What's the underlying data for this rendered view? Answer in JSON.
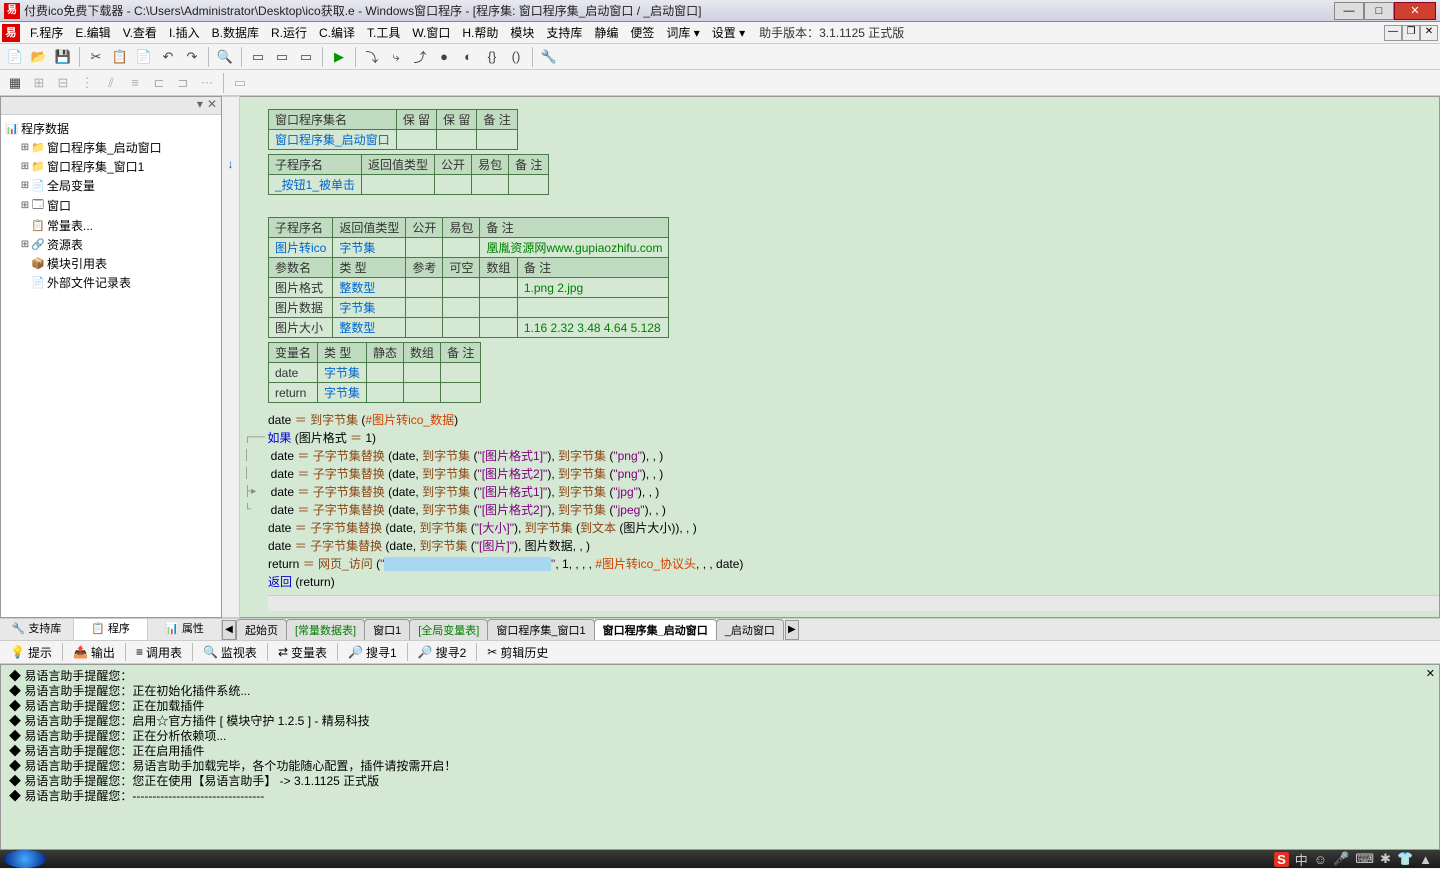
{
  "window": {
    "title": "付费ico免费下载器 - C:\\Users\\Administrator\\Desktop\\ico获取.e - Windows窗口程序 - [程序集: 窗口程序集_启动窗口 / _启动窗口]"
  },
  "menu": {
    "file": "F.程序",
    "edit": "E.编辑",
    "view": "V.查看",
    "insert": "I.插入",
    "db": "B.数据库",
    "run": "R.运行",
    "compile": "C.编译",
    "tools": "T.工具",
    "window": "W.窗口",
    "help": "H.帮助",
    "module": "模块",
    "support": "支持库",
    "static": "静编",
    "note": "便签",
    "dict": "词库 ▾",
    "settings": "设置 ▾",
    "version": "助手版本：3.1.1125 正式版"
  },
  "sidebar": {
    "header": "程序数据",
    "items": [
      {
        "l": 2,
        "exp": "⊞",
        "icon": "📁",
        "label": "窗口程序集_启动窗口"
      },
      {
        "l": 2,
        "exp": "⊞",
        "icon": "📁",
        "label": "窗口程序集_窗口1"
      },
      {
        "l": 2,
        "exp": "⊞",
        "icon": "📄",
        "label": "全局变量"
      },
      {
        "l": 2,
        "exp": "⊞",
        "icon": "🗔",
        "label": "窗口"
      },
      {
        "l": 2,
        "exp": "",
        "icon": "📋",
        "label": "常量表..."
      },
      {
        "l": 2,
        "exp": "⊞",
        "icon": "🔗",
        "label": "资源表"
      },
      {
        "l": 2,
        "exp": "",
        "icon": "📦",
        "label": "模块引用表"
      },
      {
        "l": 2,
        "exp": "",
        "icon": "📄",
        "label": "外部文件记录表"
      }
    ],
    "tabs": [
      "🔧 支持库",
      "📋 程序",
      "📊 属性"
    ]
  },
  "table1": {
    "headers": [
      "窗口程序集名",
      "保  留",
      "保  留",
      "备 注"
    ],
    "row": [
      "窗口程序集_启动窗口",
      "",
      "",
      ""
    ]
  },
  "table2": {
    "headers": [
      "子程序名",
      "返回值类型",
      "公开",
      "易包",
      "备  注"
    ],
    "row": [
      "_按钮1_被单击",
      "",
      "",
      "",
      ""
    ]
  },
  "table3": {
    "headers1": [
      "子程序名",
      "返回值类型",
      "公开",
      "易包",
      "备  注"
    ],
    "row1": [
      "图片转ico",
      "字节集",
      "",
      "",
      "凰胤资源网www.gupiaozhifu.com"
    ],
    "headers2": [
      "参数名",
      "类  型",
      "参考",
      "可空",
      "数组",
      "备  注"
    ],
    "rows2": [
      [
        "图片格式",
        "整数型",
        "",
        "",
        "",
        "1.png  2.jpg"
      ],
      [
        "图片数据",
        "字节集",
        "",
        "",
        "",
        ""
      ],
      [
        "图片大小",
        "整数型",
        "",
        "",
        "",
        "1.16  2.32  3.48  4.64  5.128"
      ]
    ]
  },
  "table4": {
    "headers": [
      "变量名",
      "类 型",
      "静态",
      "数组",
      "备 注"
    ],
    "rows": [
      [
        "date",
        "字节集",
        "",
        "",
        ""
      ],
      [
        "return",
        "字节集",
        "",
        "",
        ""
      ]
    ]
  },
  "code": {
    "l1": "date ＝ 到字节集 (#图片转ico_数据)",
    "l2": "如果 (图片格式 ＝ 1)",
    "l3": "date ＝ 子字节集替换 (date, 到字节集 (\"[图片格式1]\"), 到字节集 (\"png\"), , )",
    "l4": "date ＝ 子字节集替换 (date, 到字节集 (\"[图片格式2]\"), 到字节集 (\"png\"), , )",
    "l5": "date ＝ 子字节集替换 (date, 到字节集 (\"[图片格式1]\"), 到字节集 (\"jpg\"), , )",
    "l6": "date ＝ 子字节集替换 (date, 到字节集 (\"[图片格式2]\"), 到字节集 (\"jpeg\"), , )",
    "l7": "date ＝ 子字节集替换 (date, 到字节集 (\"[大小]\"), 到字节集 (到文本 (图片大小)), , )",
    "l8": "date ＝ 子字节集替换 (date, 到字节集 (\"[图片]\"), 图片数据, , )",
    "l9_a": "return ＝ 网页_访问 (\"",
    "l9_b": "\", 1, , , , #图片转ico_协议头, , , date)",
    "l10": "返回 (return)"
  },
  "editortabs": [
    {
      "label": "起始页",
      "cls": ""
    },
    {
      "label": "[常量数据表]",
      "cls": "gt"
    },
    {
      "label": "窗口1",
      "cls": ""
    },
    {
      "label": "[全局变量表]",
      "cls": "gt"
    },
    {
      "label": "窗口程序集_窗口1",
      "cls": ""
    },
    {
      "label": "窗口程序集_启动窗口",
      "cls": "active"
    },
    {
      "label": "_启动窗口",
      "cls": ""
    }
  ],
  "bottomtabs": [
    {
      "i": "💡",
      "t": "提示"
    },
    {
      "i": "📤",
      "t": "输出"
    },
    {
      "i": "≡",
      "t": "调用表"
    },
    {
      "i": "🔍",
      "t": "监视表"
    },
    {
      "i": "⇄",
      "t": "变量表"
    },
    {
      "i": "🔎",
      "t": "搜寻1"
    },
    {
      "i": "🔎",
      "t": "搜寻2"
    },
    {
      "i": "✂",
      "t": "剪辑历史"
    }
  ],
  "output": {
    "lines": [
      "◆ 易语言助手提醒您：",
      "◆ 易语言助手提醒您：正在初始化插件系统...",
      "◆ 易语言助手提醒您：正在加载插件",
      "◆ 易语言助手提醒您：启用☆官方插件 [ 模块守护 1.2.5 ] - 精易科技",
      "◆ 易语言助手提醒您：正在分析依赖项...",
      "◆ 易语言助手提醒您：正在启用插件",
      "◆ 易语言助手提醒您：易语言助手加载完毕，各个功能随心配置，插件请按需开启！",
      "◆ 易语言助手提醒您：您正在使用【易语言助手】 -> 3.1.1125 正式版",
      "◆ 易语言助手提醒您：---------------------------------"
    ]
  },
  "tray": [
    "中",
    "☺",
    "🎤",
    "⌨",
    "✱",
    "👕",
    "▲"
  ]
}
